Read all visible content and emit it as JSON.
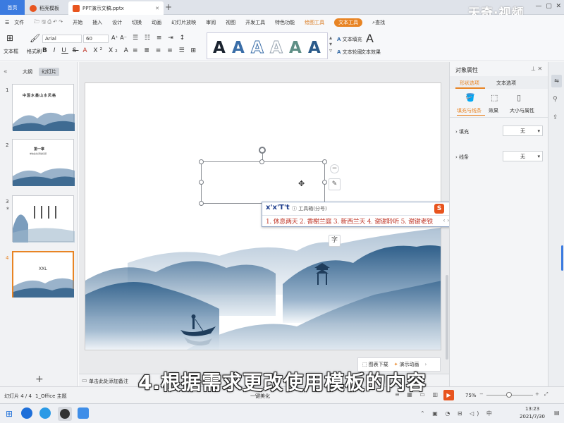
{
  "tabs": {
    "home": "首页",
    "template": "稻壳模板",
    "document": "PPT演示文稿.pptx",
    "new_tab": "+"
  },
  "watermark": "天奇·视频",
  "menu": {
    "file": "文件",
    "items": [
      "开始",
      "插入",
      "设计",
      "切换",
      "动画",
      "幻灯片放映",
      "审阅",
      "视图",
      "开发工具",
      "特色功能"
    ],
    "drawing_tools": "绘图工具",
    "text_tools": "文本工具",
    "search": "查找"
  },
  "ribbon": {
    "text_box": "文本框",
    "format_painter": "格式刷",
    "font_name": "Arial",
    "font_size": "60",
    "text_fill": "文本填充",
    "text_outline": "文本轮廓",
    "text_effects": "文本效果",
    "wordart_letter": "A",
    "wordart_colors": [
      "#1b2430",
      "#3a6ea8",
      "#7aa6d6",
      "#b9c4cf",
      "#5f8f86",
      "#2a5a8a"
    ]
  },
  "left_panel": {
    "outline_tab": "大纲",
    "slides_tab": "幻灯片",
    "slides": [
      {
        "number": "1",
        "title": "中国水墨山水风格",
        "subtitle": ""
      },
      {
        "number": "2",
        "title": "第一章",
        "subtitle": "单击此处添加标题"
      },
      {
        "number": "3",
        "title": "",
        "subtitle": ""
      },
      {
        "number": "4",
        "title": "XXL",
        "subtitle": ""
      }
    ],
    "add_slide": "+"
  },
  "ime": {
    "input": "x'x'T't",
    "hint": "工具箱(分号)",
    "candidates": "1. 休息两天   2. 香榭兰庭   3. 新西兰天   4. 谢谢聆听   5. 谢谢老铁"
  },
  "right_panel": {
    "title": "对象属性",
    "tab_shape": "形状选项",
    "tab_text": "文本选项",
    "sub_fill_line": "填充与线条",
    "sub_effects": "效果",
    "sub_size": "大小与属性",
    "fill_label": "填充",
    "fill_value": "无",
    "line_label": "线条",
    "line_value": "无"
  },
  "canvas_bottom": {
    "download": "图表下载",
    "animation": "演示动画"
  },
  "notes": "单击此处添加备注",
  "status": {
    "slide_pos": "幻灯片 4 / 4",
    "theme": "1_Office 主题",
    "beautify": "一键美化",
    "zoom": "75%"
  },
  "subtitle": "4.根据需求更改使用模板的内容",
  "taskbar": {
    "time": "13:23",
    "date": "2021/7/30"
  },
  "colors": {
    "accent": "#e88424",
    "tab_blue": "#3b7be0",
    "ink_blue": "#2f5f8a"
  }
}
